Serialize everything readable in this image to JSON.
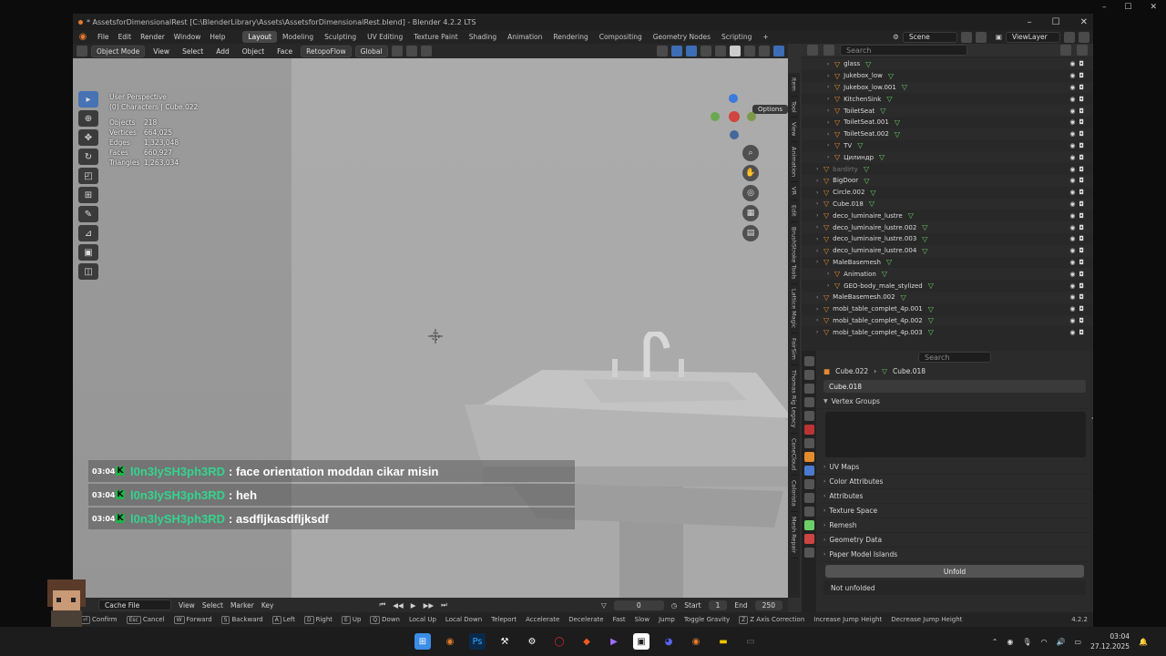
{
  "window": {
    "title": "* AssetsforDimensionalRest [C:\\BlenderLibrary\\Assets\\AssetsforDimensionalRest.blend] - Blender 4.2.2 LTS",
    "minimize": "–",
    "maximize": "☐",
    "close": "✕"
  },
  "menu": {
    "items": [
      "File",
      "Edit",
      "Render",
      "Window",
      "Help"
    ],
    "workspaces": [
      "Layout",
      "Modeling",
      "Sculpting",
      "UV Editing",
      "Texture Paint",
      "Shading",
      "Animation",
      "Rendering",
      "Compositing",
      "Geometry Nodes",
      "Scripting",
      "+"
    ],
    "active_workspace": "Layout",
    "scene": "Scene",
    "view_layer": "ViewLayer"
  },
  "viewport_header": {
    "mode": "Object Mode",
    "menus": [
      "View",
      "Select",
      "Add",
      "Object",
      "Face"
    ],
    "retopo": "RetopoFlow",
    "orientation": "Global",
    "options": "Options"
  },
  "viewport": {
    "perspective": "User Perspective",
    "collection": "(0) Characters | Cube.022",
    "stats": [
      {
        "k": "Objects",
        "v": "218"
      },
      {
        "k": "Vertices",
        "v": "664,025"
      },
      {
        "k": "Edges",
        "v": "1,323,048"
      },
      {
        "k": "Faces",
        "v": "660,927"
      },
      {
        "k": "Triangles",
        "v": "1,263,034"
      }
    ],
    "side_tabs": [
      "Item",
      "Tool",
      "View",
      "Animation",
      "VR",
      "Edit",
      "BrushStroke Tools",
      "Lattice Magic",
      "FairSim",
      "Thomas Rig Legacy",
      "ConeCloud",
      "Colorista",
      "Mesh Repair"
    ]
  },
  "chat": [
    {
      "time": "03:04",
      "user": "l0n3lySH3ph3RD",
      "msg": ": face orientation moddan cikar misin"
    },
    {
      "time": "03:04",
      "user": "l0n3lySH3ph3RD",
      "msg": ": heh"
    },
    {
      "time": "03:04",
      "user": "l0n3lySH3ph3RD",
      "msg": ": asdfljkasdfljksdf"
    }
  ],
  "timeline": {
    "cache": "Cache File",
    "menus": [
      "View",
      "Select",
      "Marker",
      "Key"
    ],
    "frame": "0",
    "start_label": "Start",
    "start": "1",
    "end_label": "End",
    "end": "250"
  },
  "statusbar": [
    {
      "k": "⏎",
      "t": "Confirm"
    },
    {
      "k": "Esc",
      "t": "Cancel"
    },
    {
      "k": "W",
      "t": "Forward"
    },
    {
      "k": "S",
      "t": "Backward"
    },
    {
      "k": "A",
      "t": "Left"
    },
    {
      "k": "D",
      "t": "Right"
    },
    {
      "k": "E",
      "t": "Up"
    },
    {
      "k": "Q",
      "t": "Down"
    },
    {
      "k": "",
      "t": "Local Up"
    },
    {
      "k": "",
      "t": "Local Down"
    },
    {
      "k": "",
      "t": "Teleport"
    },
    {
      "k": "",
      "t": "Accelerate"
    },
    {
      "k": "",
      "t": "Decelerate"
    },
    {
      "k": "",
      "t": "Fast"
    },
    {
      "k": "",
      "t": "Slow"
    },
    {
      "k": "",
      "t": "Jump"
    },
    {
      "k": "",
      "t": "Toggle Gravity"
    },
    {
      "k": "Z",
      "t": "Z Axis Correction"
    },
    {
      "k": "",
      "t": "Increase Jump Height"
    },
    {
      "k": "",
      "t": "Decrease Jump Height"
    }
  ],
  "version": "4.2.2",
  "outliner": {
    "search_placeholder": "Search",
    "rows": [
      {
        "name": "glass",
        "indent": 2,
        "dim": false
      },
      {
        "name": "Jukebox_low",
        "indent": 2,
        "dim": false
      },
      {
        "name": "Jukebox_low.001",
        "indent": 2,
        "dim": false
      },
      {
        "name": "KitchenSink",
        "indent": 2,
        "dim": false
      },
      {
        "name": "ToiletSeat",
        "indent": 2,
        "dim": false
      },
      {
        "name": "ToiletSeat.001",
        "indent": 2,
        "dim": false
      },
      {
        "name": "ToiletSeat.002",
        "indent": 2,
        "dim": false
      },
      {
        "name": "TV",
        "indent": 2,
        "dim": false
      },
      {
        "name": "Цилиндр",
        "indent": 2,
        "dim": false
      },
      {
        "name": "bardirty",
        "indent": 1,
        "dim": true
      },
      {
        "name": "BigDoor",
        "indent": 1,
        "dim": false
      },
      {
        "name": "Circle.002",
        "indent": 1,
        "dim": false
      },
      {
        "name": "Cube.018",
        "indent": 1,
        "dim": false
      },
      {
        "name": "deco_luminaire_lustre",
        "indent": 1,
        "dim": false
      },
      {
        "name": "deco_luminaire_lustre.002",
        "indent": 1,
        "dim": false
      },
      {
        "name": "deco_luminaire_lustre.003",
        "indent": 1,
        "dim": false
      },
      {
        "name": "deco_luminaire_lustre.004",
        "indent": 1,
        "dim": false
      },
      {
        "name": "MaleBasemesh",
        "indent": 1,
        "dim": false
      },
      {
        "name": "Animation",
        "indent": 2,
        "dim": false
      },
      {
        "name": "GEO-body_male_stylized",
        "indent": 2,
        "dim": false
      },
      {
        "name": "MaleBasemesh.002",
        "indent": 1,
        "dim": false
      },
      {
        "name": "mobi_table_complet_4p.001",
        "indent": 1,
        "dim": false
      },
      {
        "name": "mobi_table_complet_4p.002",
        "indent": 1,
        "dim": false
      },
      {
        "name": "mobi_table_complet_4p.003",
        "indent": 1,
        "dim": false
      }
    ]
  },
  "properties": {
    "search_placeholder": "Search",
    "object": "Cube.022",
    "mesh": "Cube.018",
    "mesh_field": "Cube.018",
    "panels_top": [
      "Vertex Groups"
    ],
    "panels": [
      "UV Maps",
      "Color Attributes",
      "Attributes",
      "Texture Space",
      "Remesh",
      "Geometry Data",
      "Paper Model Islands"
    ],
    "unfold": "Unfold",
    "not_unfolded": "Not unfolded"
  },
  "taskbar": {
    "time": "03:04",
    "date": "27.12.2025"
  },
  "colors": {
    "accent": "#4772b3",
    "blender_orange": "#e47b2c",
    "chat_user": "#33d48e"
  }
}
